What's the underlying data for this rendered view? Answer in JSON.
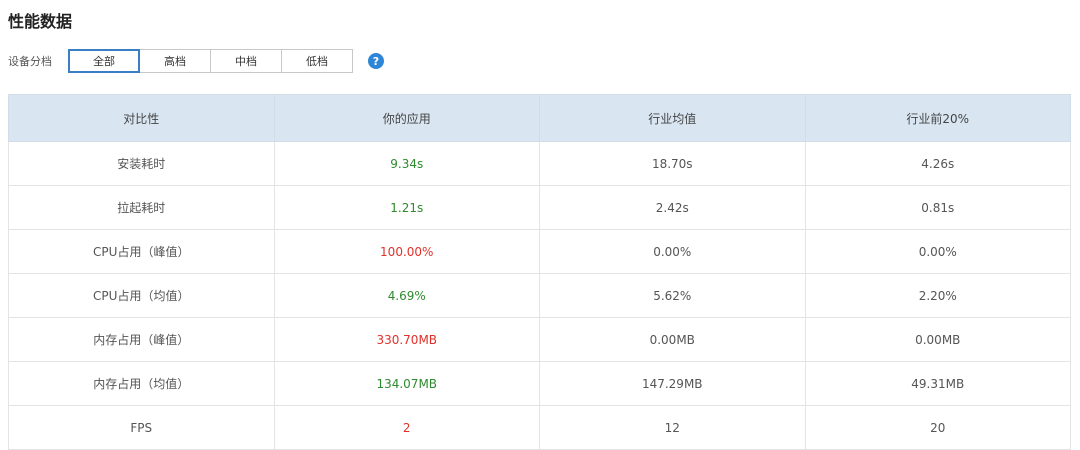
{
  "page_title": "性能数据",
  "filter": {
    "label": "设备分档",
    "options": [
      {
        "label": "全部",
        "active": true
      },
      {
        "label": "高档",
        "active": false
      },
      {
        "label": "中档",
        "active": false
      },
      {
        "label": "低档",
        "active": false
      }
    ],
    "help_glyph": "?"
  },
  "colors": {
    "accent": "#3a7fc4",
    "good": "#2e8b2e",
    "bad": "#e0302a",
    "header_bg": "#d9e6f2"
  },
  "table": {
    "headers": [
      "对比性",
      "你的应用",
      "行业均值",
      "行业前20%"
    ],
    "rows": [
      {
        "metric": "安装耗时",
        "app": "9.34s",
        "status": "good",
        "avg": "18.70s",
        "top20": "4.26s"
      },
      {
        "metric": "拉起耗时",
        "app": "1.21s",
        "status": "good",
        "avg": "2.42s",
        "top20": "0.81s"
      },
      {
        "metric": "CPU占用（峰值）",
        "app": "100.00%",
        "status": "bad",
        "avg": "0.00%",
        "top20": "0.00%"
      },
      {
        "metric": "CPU占用（均值）",
        "app": "4.69%",
        "status": "good",
        "avg": "5.62%",
        "top20": "2.20%"
      },
      {
        "metric": "内存占用（峰值）",
        "app": "330.70MB",
        "status": "bad",
        "avg": "0.00MB",
        "top20": "0.00MB"
      },
      {
        "metric": "内存占用（均值）",
        "app": "134.07MB",
        "status": "good",
        "avg": "147.29MB",
        "top20": "49.31MB"
      },
      {
        "metric": "FPS",
        "app": "2",
        "status": "bad",
        "avg": "12",
        "top20": "20"
      }
    ]
  }
}
